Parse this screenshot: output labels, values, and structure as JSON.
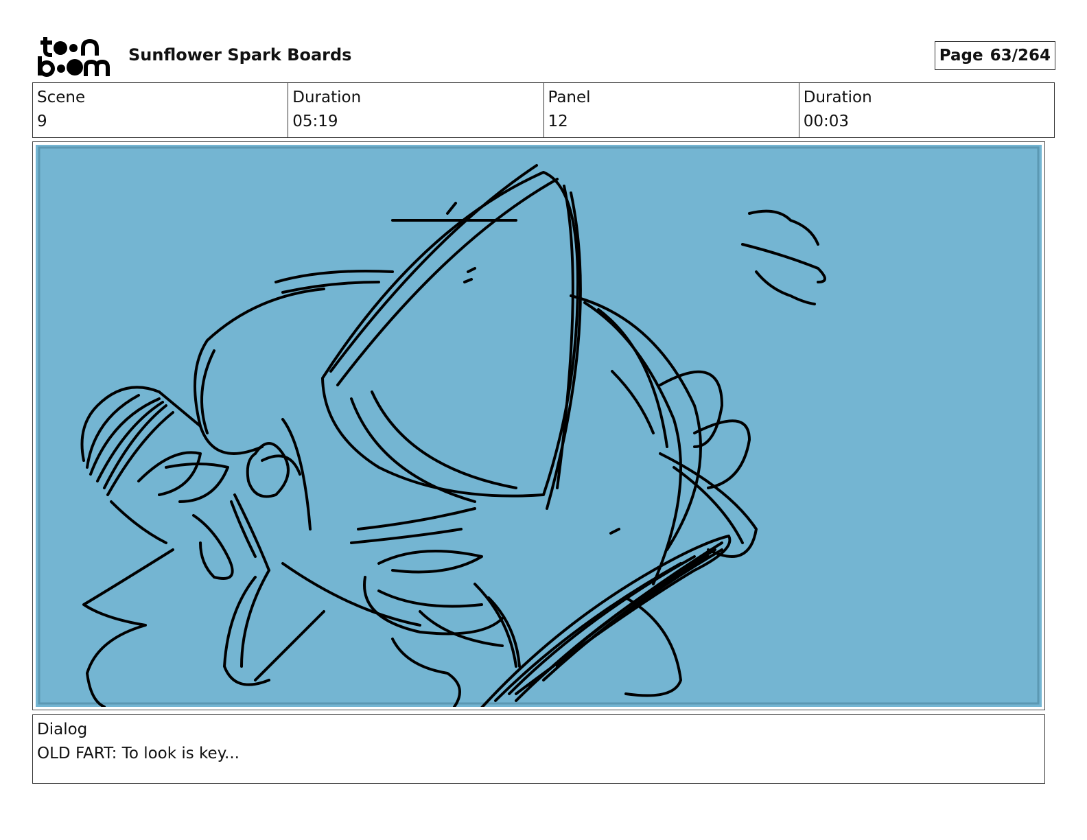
{
  "header": {
    "logo": {
      "line1": "toon",
      "line2": "boom"
    },
    "project_title": "Sunflower Spark Boards",
    "page_label": "Page",
    "page_value": "63/264"
  },
  "info": {
    "scene_label": "Scene",
    "scene_value": "9",
    "scene_duration_label": "Duration",
    "scene_duration_value": "05:19",
    "panel_label": "Panel",
    "panel_value": "12",
    "panel_duration_label": "Duration",
    "panel_duration_value": "00:03"
  },
  "panel": {
    "background_color": "#74b5d2",
    "line_color": "#000000"
  },
  "dialog": {
    "label": "Dialog",
    "text": "OLD FART: To look is key..."
  }
}
